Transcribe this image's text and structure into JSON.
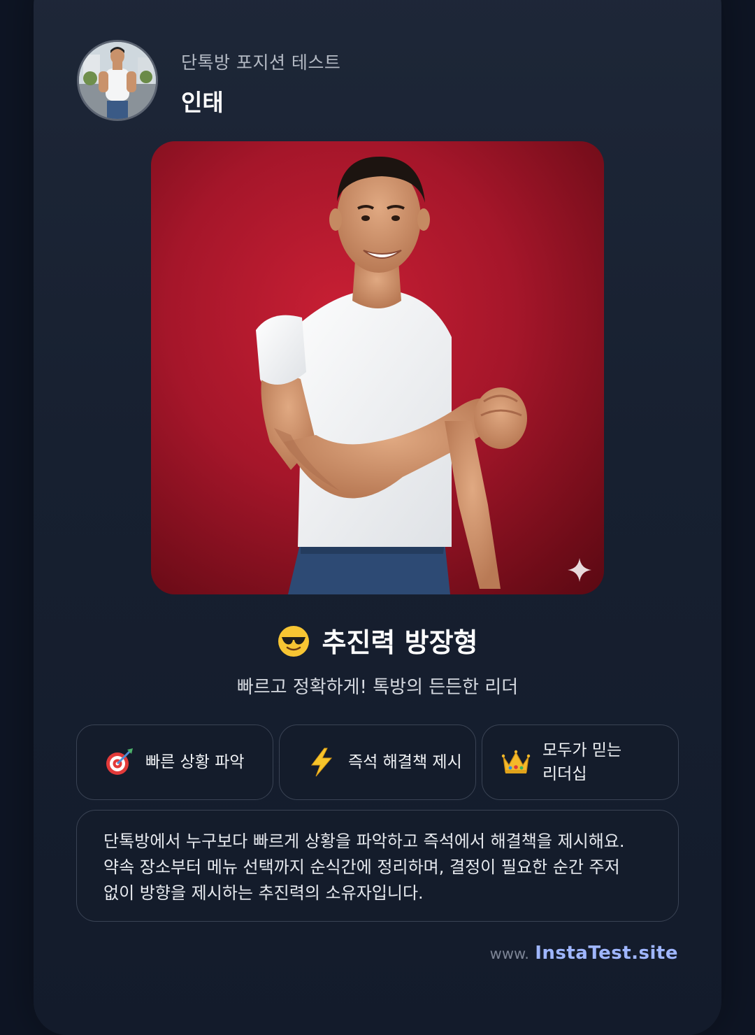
{
  "header": {
    "subtitle": "단톡방 포지션 테스트",
    "name": "인태"
  },
  "result": {
    "emoji_icon": "sunglasses-face-icon",
    "title": "추진력 방장형",
    "tagline": "빠르고 정확하게! 톡방의 든든한 리더"
  },
  "traits": [
    {
      "icon": "target-dart-icon",
      "label": "빠른 상황 파악"
    },
    {
      "icon": "lightning-icon",
      "label": "즉석 해결책 제시"
    },
    {
      "icon": "crown-icon",
      "label": "모두가 믿는\n리더십"
    }
  ],
  "description": "단톡방에서 누구보다 빠르게 상황을 파악하고 즉석에서 해결책을 제시해요. 약속 장소부터 메뉴 선택까지 순식간에 정리하며, 결정이 필요한 순간 주저 없이 방향을 제시하는 추진력의 소유자입니다.",
  "footer": {
    "prefix": "www.",
    "site": "InstaTest.site"
  },
  "colors": {
    "background": "#0e1524",
    "card": "#1b2434",
    "hero_red": "#c81f34",
    "accent_link": "#9fb6ff"
  }
}
